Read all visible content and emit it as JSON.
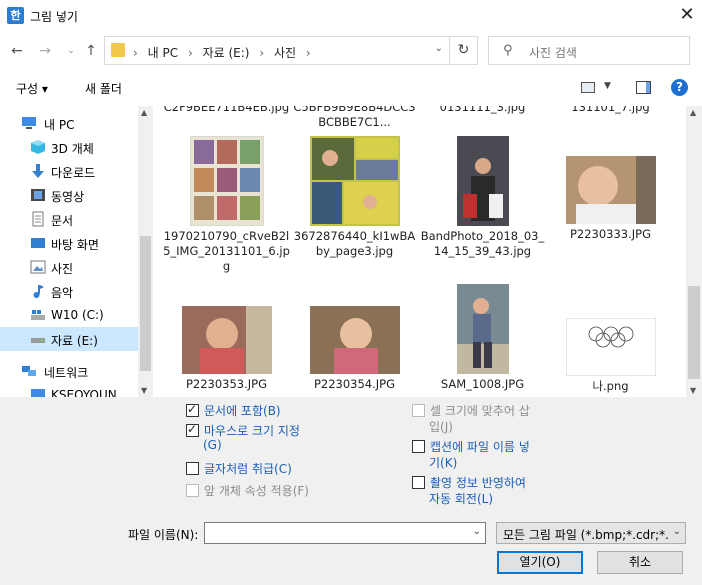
{
  "window": {
    "title": "그림 넣기",
    "app_icon_glyph": "한"
  },
  "address": {
    "crumbs": [
      "내 PC",
      "자료 (E:)",
      "사진"
    ],
    "separator": "›"
  },
  "search": {
    "placeholder": "사진 검색"
  },
  "toolbar": {
    "organize": "구성 ▾",
    "new_folder": "새 폴더",
    "help": "?"
  },
  "nav": {
    "items": [
      {
        "label": "내 PC",
        "icon": "pc-icon",
        "color": "#3c8ce6"
      },
      {
        "label": "3D 개체",
        "icon": "cube-3d-icon",
        "color": "#36b6e3"
      },
      {
        "label": "다운로드",
        "icon": "download-icon",
        "color": "#2f7fd3"
      },
      {
        "label": "동영상",
        "icon": "film-icon",
        "color": "#4a4a4a"
      },
      {
        "label": "문서",
        "icon": "document-icon",
        "color": "#8a8a8a"
      },
      {
        "label": "바탕 화면",
        "icon": "desktop-icon",
        "color": "#2f7fd3"
      },
      {
        "label": "사진",
        "icon": "picture-icon",
        "color": "#5a8fc7"
      },
      {
        "label": "음악",
        "icon": "music-icon",
        "color": "#2f7fd3"
      },
      {
        "label": "W10 (C:)",
        "icon": "windows-drive-icon",
        "color": "#666666"
      },
      {
        "label": "자료 (E:)",
        "icon": "drive-icon",
        "color": "#666666"
      },
      {
        "label": "네트워크",
        "icon": "network-icon",
        "color": "#2f7fd3"
      },
      {
        "label": "KSEOYOUN",
        "icon": "computer-icon",
        "color": "#3c8ce6"
      }
    ],
    "selected": "자료 (E:)"
  },
  "files": {
    "row0": [
      {
        "name": "C2F9BEE711B4EB.jpg"
      },
      {
        "name": "C5BFB9B9E8B4DCC3BCBBE7C1..."
      },
      {
        "name": "0131111_3.jpg"
      },
      {
        "name": "131101_7.jpg"
      }
    ],
    "row1": [
      {
        "name": "1970210790_cRveB2l5_IMG_20131101_6.jpg",
        "color": "#8a7a5a"
      },
      {
        "name": "3672876440_kI1wBAby_page3.jpg",
        "color": "#c4c248"
      },
      {
        "name": "BandPhoto_2018_03_14_15_39_43.jpg",
        "color": "#4a4a52"
      },
      {
        "name": "P2230333.JPG",
        "color": "#b59472"
      }
    ],
    "row2": [
      {
        "name": "P2230353.JPG",
        "color": "#9a6a5a"
      },
      {
        "name": "P2230354.JPG",
        "color": "#8a7055"
      },
      {
        "name": "SAM_1008.JPG",
        "color": "#7a8a92"
      },
      {
        "name": "나.png",
        "color": "#ffffff"
      }
    ]
  },
  "options": {
    "include_in_doc": "문서에 포함(B)",
    "size_by_mouse": "마우스로 크기 지정",
    "size_by_mouse_key": "(G)",
    "treat_as_char": "글자처럼 취급(C)",
    "apply_prev_props": "앞 개체 속성 적용(F)",
    "fit_cell_1": "셀 크기에 맞추어 삽",
    "fit_cell_2": "입(J)",
    "caption_name_1": "캡션에 파일 이름 넣",
    "caption_name_2": "기(K)",
    "auto_rotate_1": "촬영 정보 반영하여",
    "auto_rotate_2": "자동 회전(L)"
  },
  "footer": {
    "filename_label": "파일 이름(N):",
    "filename_value": "",
    "filetype": "모든 그림 파일 (*.bmp;*.cdr;*.c",
    "open": "열기(O)",
    "cancel": "취소"
  }
}
